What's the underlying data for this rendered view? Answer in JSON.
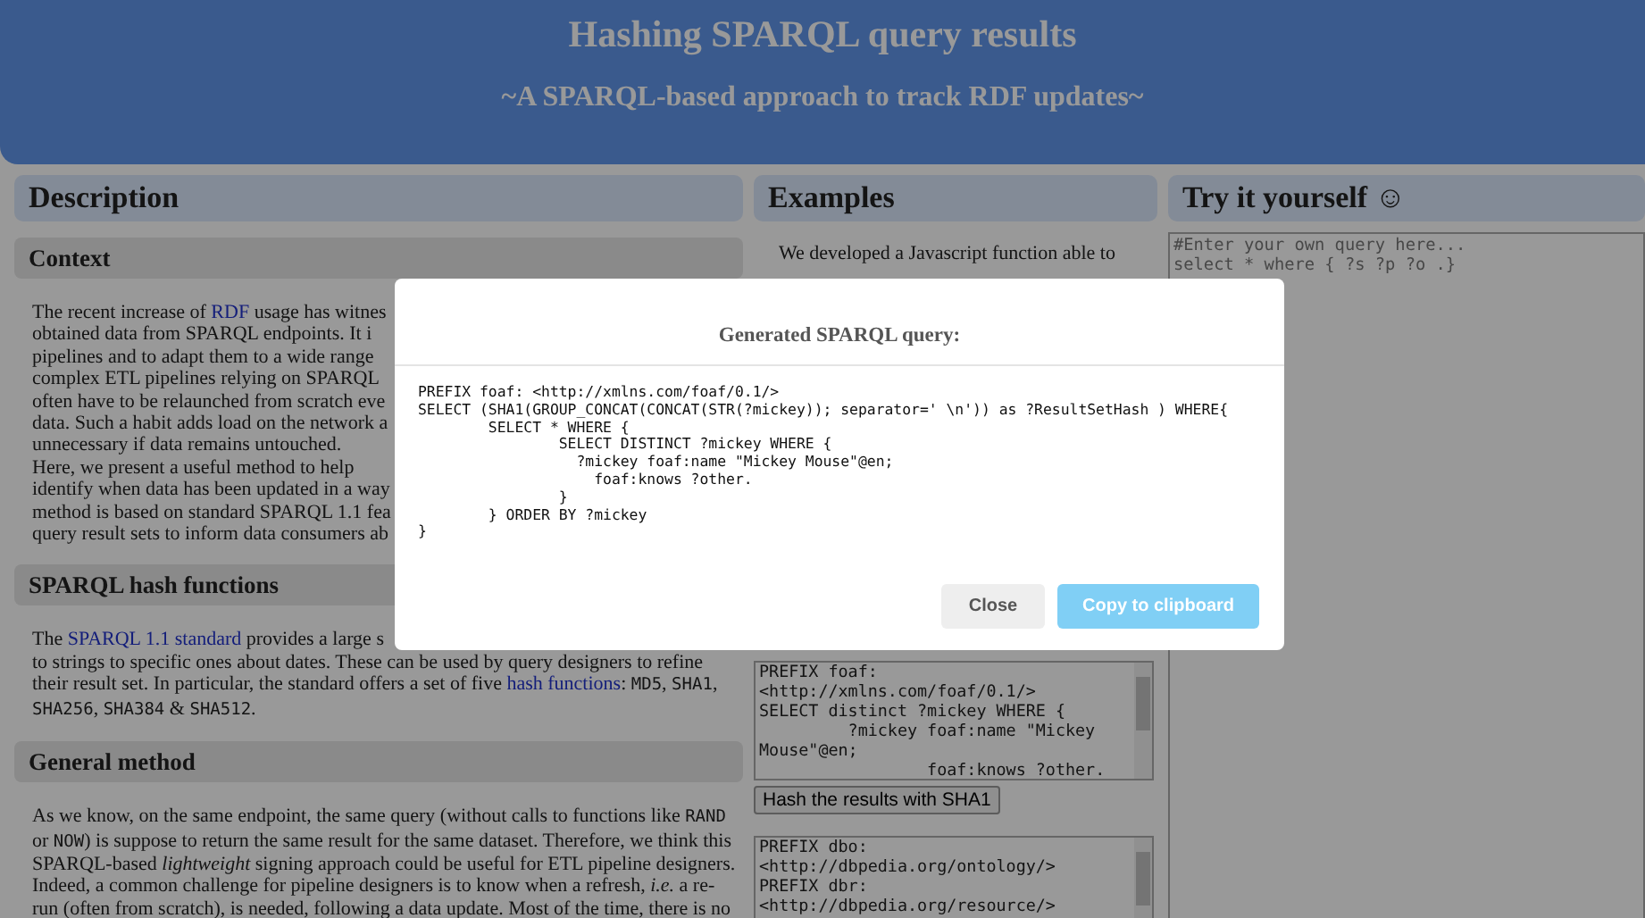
{
  "header": {
    "title": "Hashing SPARQL query results",
    "subtitle": "~A SPARQL-based approach to track RDF updates~"
  },
  "description": {
    "heading": "Description",
    "sections": [
      {
        "heading": "Context",
        "lines": [
          [
            {
              "kind": "text",
              "text": "The recent increase of "
            },
            {
              "kind": "link",
              "text": "RDF"
            },
            {
              "kind": "text",
              "text": " usage has witnes"
            }
          ],
          [
            {
              "kind": "text",
              "text": "obtained data from SPARQL endpoints. It i"
            }
          ],
          [
            {
              "kind": "text",
              "text": "pipelines and to adapt them to a wide range"
            }
          ],
          [
            {
              "kind": "text",
              "text": "complex ETL pipelines relying on SPARQL"
            }
          ],
          [
            {
              "kind": "text",
              "text": "often have to be relaunched from scratch eve"
            }
          ],
          [
            {
              "kind": "text",
              "text": "data. Such a habit adds load on the network a"
            }
          ],
          [
            {
              "kind": "text",
              "text": "unnecessary if data remains untouched."
            }
          ],
          [
            {
              "kind": "text",
              "text": "Here, we present a useful method to help"
            }
          ],
          [
            {
              "kind": "text",
              "text": "identify when data has been updated in a way"
            }
          ],
          [
            {
              "kind": "text",
              "text": "method is based on standard SPARQL 1.1 fea"
            }
          ],
          [
            {
              "kind": "text",
              "text": "query result sets to inform data consumers ab"
            }
          ]
        ]
      },
      {
        "heading": "SPARQL hash functions",
        "lines": [
          [
            {
              "kind": "text",
              "text": "The "
            },
            {
              "kind": "link",
              "text": "SPARQL 1.1 standard"
            },
            {
              "kind": "text",
              "text": " provides a large s"
            }
          ],
          [
            {
              "kind": "text",
              "text": "to strings to specific ones about dates. These can be used by query designers to refine"
            }
          ],
          [
            {
              "kind": "text",
              "text": "their result set. In particular, the standard offers a set of five "
            },
            {
              "kind": "link",
              "text": "hash functions"
            },
            {
              "kind": "text",
              "text": ": "
            },
            {
              "kind": "code",
              "text": "MD5"
            },
            {
              "kind": "text",
              "text": ", "
            },
            {
              "kind": "code",
              "text": "SHA1"
            },
            {
              "kind": "text",
              "text": ","
            }
          ],
          [
            {
              "kind": "code",
              "text": "SHA256"
            },
            {
              "kind": "text",
              "text": ", "
            },
            {
              "kind": "code",
              "text": "SHA384"
            },
            {
              "kind": "text",
              "text": " & "
            },
            {
              "kind": "code",
              "text": "SHA512"
            },
            {
              "kind": "text",
              "text": "."
            }
          ]
        ]
      },
      {
        "heading": "General method",
        "lines": [
          [
            {
              "kind": "text",
              "text": "As we know, on the same endpoint, the same query (without calls to functions like "
            },
            {
              "kind": "code",
              "text": "RAND"
            }
          ],
          [
            {
              "kind": "text",
              "text": "or "
            },
            {
              "kind": "code",
              "text": "NOW"
            },
            {
              "kind": "text",
              "text": ") is suppose to return the same result for the same dataset. Therefore, we think this"
            }
          ],
          [
            {
              "kind": "text",
              "text": "SPARQL-based "
            },
            {
              "kind": "em",
              "text": "lightweight"
            },
            {
              "kind": "text",
              "text": " signing approach could be useful for ETL pipeline designers."
            }
          ],
          [
            {
              "kind": "text",
              "text": "Indeed, a common challenge for pipeline designers is to know when a refresh, "
            },
            {
              "kind": "em",
              "text": "i.e."
            },
            {
              "kind": "text",
              "text": " a re-"
            }
          ],
          [
            {
              "kind": "text",
              "text": "run (often from scratch), is needed, following a data update. Most of the time, there is no"
            }
          ]
        ]
      }
    ]
  },
  "examples": {
    "heading": "Examples",
    "intro": "We developed a Javascript function able to",
    "queries": [
      {
        "text": "PREFIX foaf:\n<http://xmlns.com/foaf/0.1/>\nSELECT distinct ?mickey WHERE {\n         ?mickey foaf:name \"Mickey\nMouse\"@en;\n                 foaf:knows ?other.",
        "button": "Hash the results with SHA1"
      },
      {
        "text": "PREFIX dbo:\n<http://dbpedia.org/ontology/>\nPREFIX dbr:\n<http://dbpedia.org/resource/>"
      }
    ]
  },
  "try": {
    "heading": "Try it yourself ☺",
    "placeholder": "#Enter your own query here...\nselect * where { ?s ?p ?o .}"
  },
  "modal": {
    "title": "Generated SPARQL query:",
    "code": "PREFIX foaf: <http://xmlns.com/foaf/0.1/>\nSELECT (SHA1(GROUP_CONCAT(CONCAT(STR(?mickey)); separator=' \\n')) as ?ResultSetHash ) WHERE{\n        SELECT * WHERE {\n                SELECT DISTINCT ?mickey WHERE {\n                  ?mickey foaf:name \"Mickey Mouse\"@en;\n                    foaf:knows ?other.\n                }\n        } ORDER BY ?mickey\n}",
    "buttons": [
      {
        "label": "Close",
        "kind": "secondary"
      },
      {
        "label": "Copy to clipboard",
        "kind": "primary"
      }
    ]
  }
}
